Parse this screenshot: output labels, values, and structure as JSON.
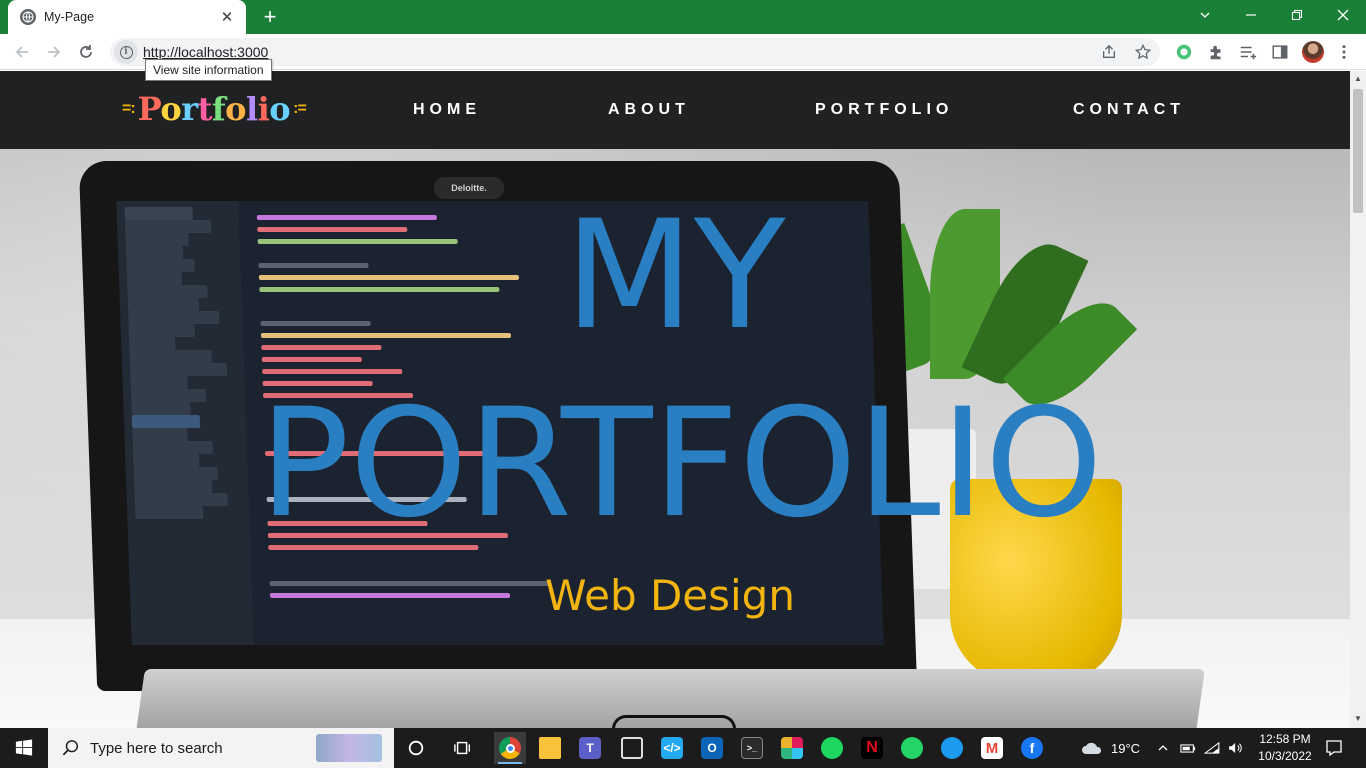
{
  "browser": {
    "tab_title": "My-Page",
    "tab_close": "✕",
    "new_tab": "+",
    "url": "http://localhost:3000",
    "tooltip": "View site information",
    "titlebar_color": "#1a7f37"
  },
  "site": {
    "logo": "Portfolio",
    "logo_dashes_left": "=:",
    "logo_dashes_right": ":=",
    "nav": [
      "HOME",
      "ABOUT",
      "PORTFOLIO",
      "CONTACT"
    ],
    "hero_line1": "MY",
    "hero_line2": "PORTFOLIO",
    "hero_subtitle": "Web Design",
    "title_color": "#2a7ec2",
    "subtitle_color": "#f2b50f",
    "header_bg": "#1f2123",
    "laptop_brand": "Deloitte."
  },
  "taskbar": {
    "search_placeholder": "Type here to search",
    "apps": [
      "chrome-icon",
      "file-explorer-icon",
      "teams-icon",
      "news-icon",
      "vscode-icon",
      "outlook-icon",
      "terminal-icon",
      "slack-icon",
      "spotify-icon",
      "netflix-icon",
      "whatsapp-icon",
      "twitter-icon",
      "gmail-icon",
      "facebook-icon"
    ],
    "weather": "19°C",
    "time": "12:58 PM",
    "date": "10/3/2022"
  }
}
